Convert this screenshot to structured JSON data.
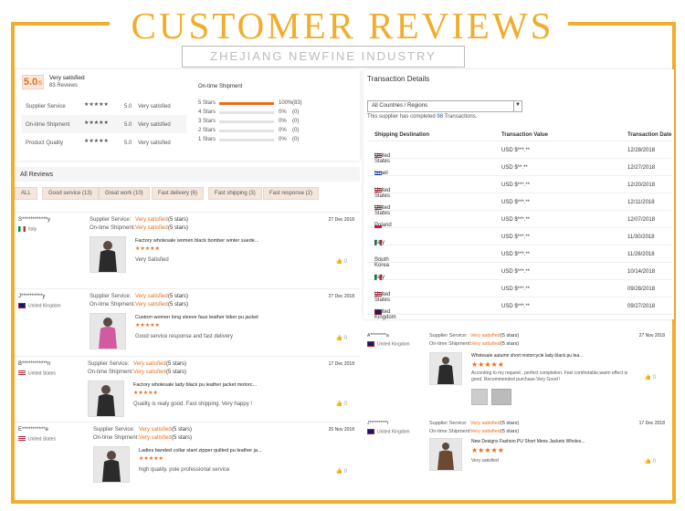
{
  "banner": {
    "title": "CUSTOMER REVIEWS",
    "company": "ZHEJIANG NEWFINE INDUSTRY CO.,LTD."
  },
  "summary": {
    "score": "5.0",
    "score_suffix": "/5",
    "satisfaction": "Very satisfied",
    "review_count": "83 Reviews",
    "ratings": [
      {
        "label": "Supplier Service",
        "value": "5.0",
        "text": "Very satisfied"
      },
      {
        "label": "On-time Shipment",
        "value": "5.0",
        "text": "Very satisfied"
      },
      {
        "label": "Product Quality",
        "value": "5.0",
        "text": "Very satisfied"
      }
    ],
    "shipment_title": "On-time Shipment",
    "distribution": [
      {
        "label": "5 Stars",
        "percent": "100%",
        "count": "(83)",
        "fill": 1
      },
      {
        "label": "4 Stars",
        "percent": "0%",
        "count": "(0)",
        "fill": 0
      },
      {
        "label": "3 Stars",
        "percent": "0%",
        "count": "(0)",
        "fill": 0
      },
      {
        "label": "2 Stars",
        "percent": "0%",
        "count": "(0)",
        "fill": 0
      },
      {
        "label": "1 Stars",
        "percent": "0%",
        "count": "(0)",
        "fill": 0
      }
    ]
  },
  "all_reviews": {
    "title": "All Reviews",
    "tags": [
      "ALL",
      "Good service (13)",
      "Great work (10)",
      "Fast delivery (6)",
      "Fast shipping (3)",
      "Fast response (2)"
    ]
  },
  "labels": {
    "supplier_service": "Supplier Service:",
    "ontime": "On-time Shipment:",
    "stars5": "(5 stars)",
    "very_satisfied": "Very satisfied",
    "likes": "0",
    "stars": "★★★★★"
  },
  "reviews": [
    {
      "name": "S************y",
      "country": "Italy",
      "date": "27 Dec 2018",
      "product": "Factory wholesale women black bomber winter suede...",
      "comment": "Very Satisfied"
    },
    {
      "name": "J**********y",
      "country": "United Kingdom",
      "date": "27 Dec 2018",
      "product": "Custom women long sleeve faux leather biker pu jacket",
      "comment": "Good service response and fast delivery"
    },
    {
      "name": "B************n",
      "country": "United States",
      "date": "17 Dec 2018",
      "product": "Factory wholesale lady black pu leather jacket motorc...",
      "comment": "Quality is realy good. Fast shipping. Very happy !"
    },
    {
      "name": "E***********e",
      "country": "United States",
      "date": "25 Nov 2018",
      "product": "Ladies banded collar slant zipper quilted pu leather ja...",
      "comment": "high quality. pole professional service"
    }
  ],
  "transactions": {
    "title": "Transaction Details",
    "filter": "All Countries / Regions",
    "completed_prefix": "This supplier has completed",
    "completed_count": "98",
    "completed_suffix": "Transactions.",
    "headers": [
      "Shipping Destination",
      "Transaction Value",
      "Transaction Date"
    ],
    "rows": [
      {
        "country": "United States",
        "value": "USD $***.**",
        "date": "12/28/2018"
      },
      {
        "country": "Israel",
        "value": "USD $**.**",
        "date": "12/27/2018"
      },
      {
        "country": "United States",
        "value": "USD $***.**",
        "date": "12/20/2018"
      },
      {
        "country": "United States",
        "value": "USD $***.**",
        "date": "12/11/2018"
      },
      {
        "country": "Poland",
        "value": "USD $***.**",
        "date": "12/07/2018"
      },
      {
        "country": "Italy",
        "value": "USD $***.**",
        "date": "11/30/2018"
      },
      {
        "country": "South Korea",
        "value": "USD $***.**",
        "date": "11/26/2018"
      },
      {
        "country": "Italy",
        "value": "USD $***.**",
        "date": "10/14/2018"
      },
      {
        "country": "United States",
        "value": "USD $***.**",
        "date": "09/28/2018"
      },
      {
        "country": "United Kingdom",
        "value": "USD $***.**",
        "date": "09/27/2018"
      }
    ]
  },
  "right_reviews": [
    {
      "name": "A*********a",
      "country": "United Kingdom",
      "date": "27 Nov 2018",
      "product": "Wholesale autumn short motorcycle lady black pu lea...",
      "comment": "According to my request , perfect completion. Feel comfortable,warm effect is good. Recommended purchase.Very Good !"
    },
    {
      "name": "J**********r",
      "country": "United Kingdom",
      "date": "17 Dec 2018",
      "product": "New Designs Fashion PU Short Mens Jackets Wholes...",
      "comment": "Very satisfied"
    }
  ]
}
